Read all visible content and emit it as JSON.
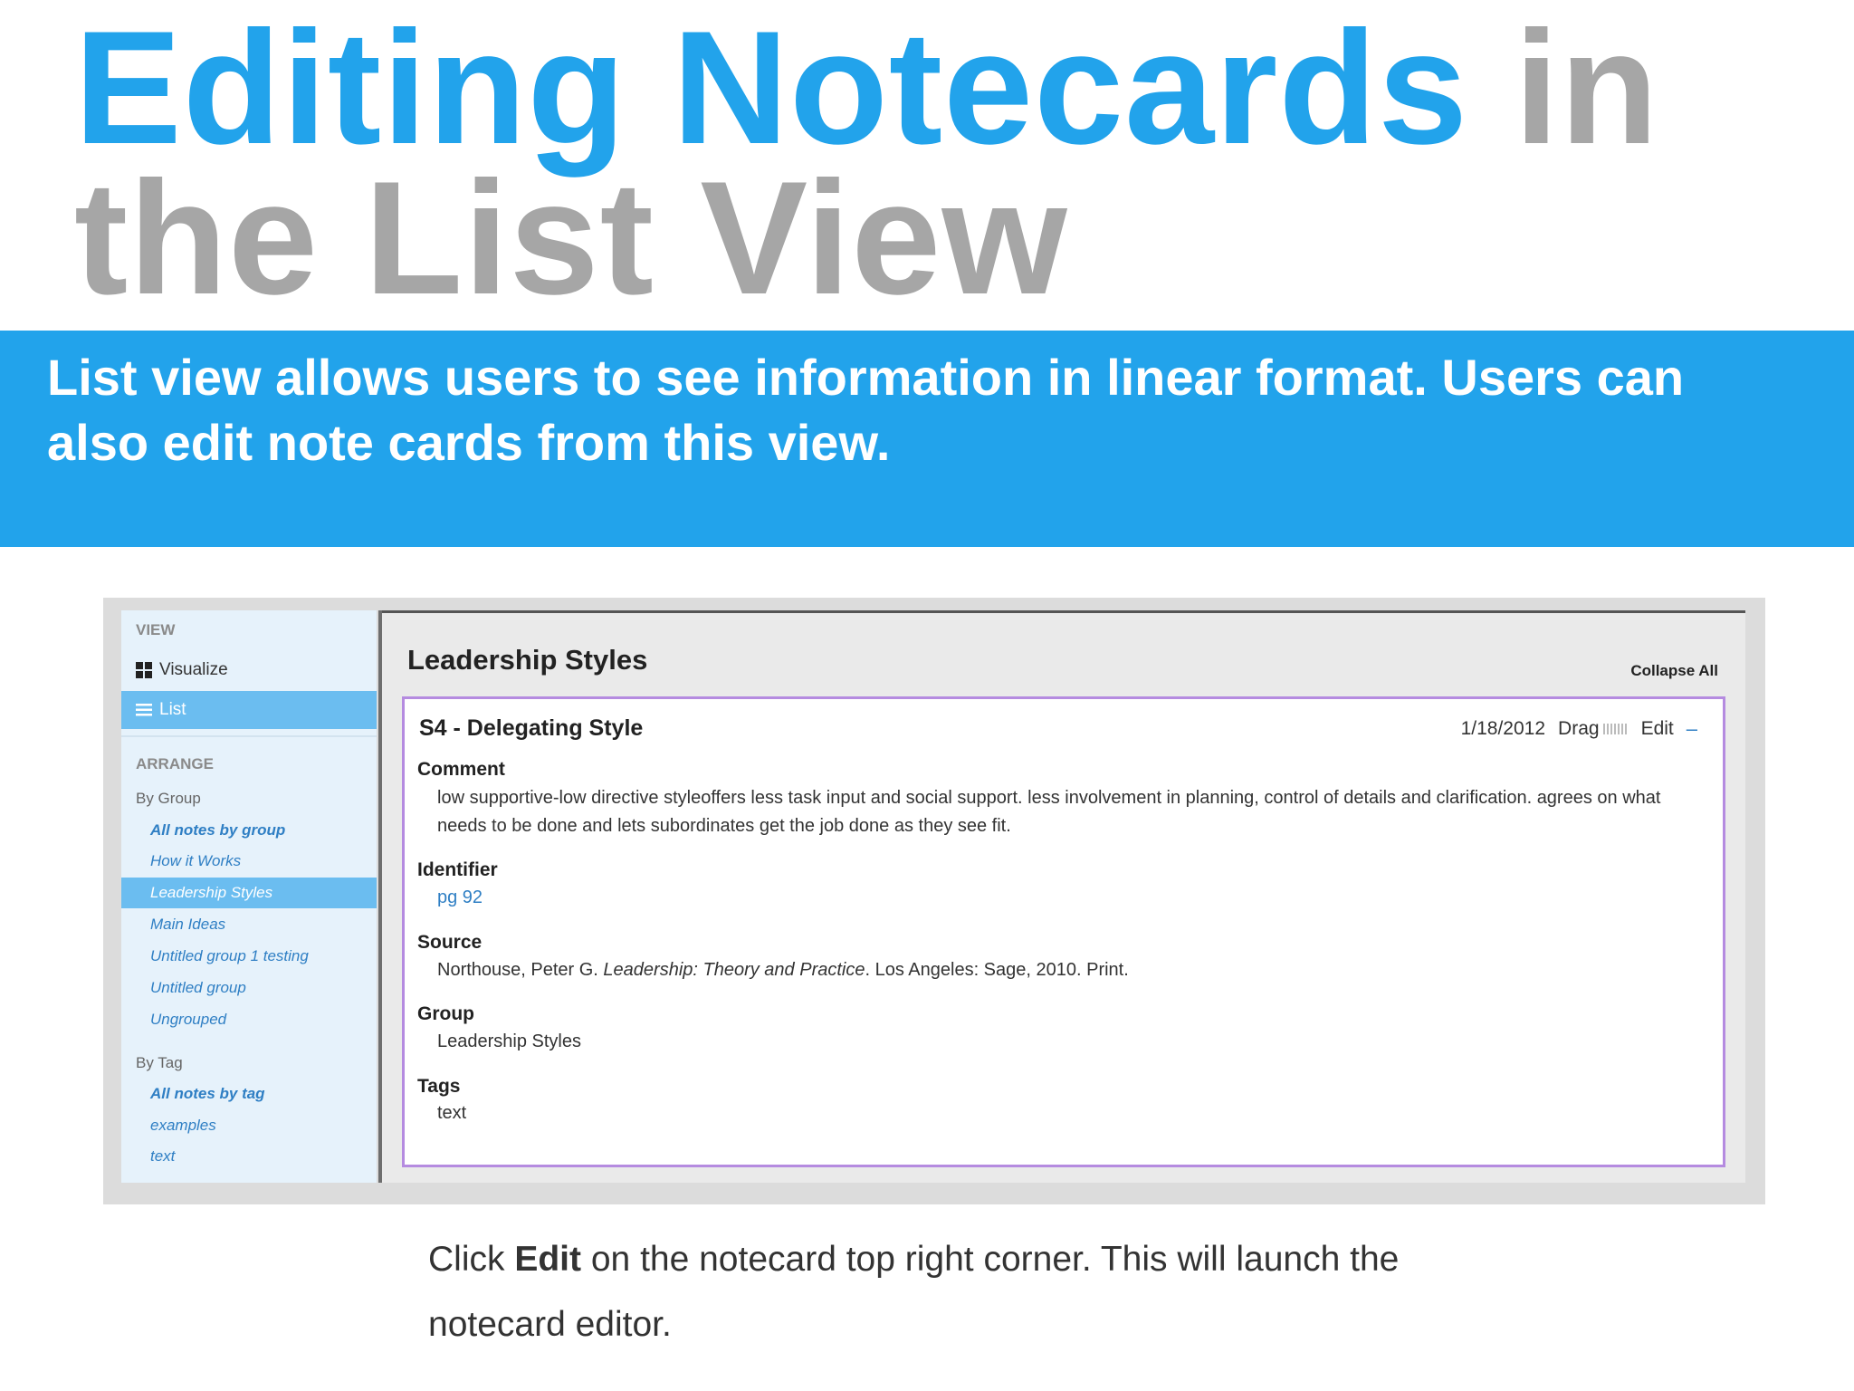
{
  "slide": {
    "title_part1": "Editing Notecards",
    "title_part2": " in",
    "title_line2": "the List View",
    "banner_text": "List view allows users to see information in linear format. Users can also edit note cards from this view.",
    "caption_pre": "Click ",
    "caption_bold": "Edit",
    "caption_post": " on the notecard top right corner. This will launch the notecard editor."
  },
  "sidebar": {
    "view_label": "VIEW",
    "visualize": "Visualize",
    "list": "List",
    "arrange_label": "ARRANGE",
    "by_group": "By Group",
    "groups": [
      "All notes by group",
      "How it Works",
      "Leadership Styles",
      "Main Ideas",
      "Untitled group 1 testing",
      "Untitled group",
      "Ungrouped"
    ],
    "by_tag": "By Tag",
    "tags": [
      "All notes by tag",
      "examples",
      "text"
    ]
  },
  "main": {
    "group_title": "Leadership Styles",
    "collapse_all": "Collapse All"
  },
  "card": {
    "title": "S4 - Delegating Style",
    "date": "1/18/2012",
    "drag": "Drag",
    "edit": "Edit",
    "collapse_symbol": "–",
    "comment_label": "Comment",
    "comment": "low supportive-low directive styleoffers less task input and social support. less involvement in planning, control of details and clarification. agrees on what needs to be done and lets subordinates get the job done as they see fit.",
    "identifier_label": "Identifier",
    "identifier": "pg 92",
    "source_label": "Source",
    "source_pre": "Northouse, Peter G. ",
    "source_italic": "Leadership: Theory and Practice",
    "source_post": ". Los Angeles: Sage, 2010. Print.",
    "group_label": "Group",
    "group": "Leadership Styles",
    "tags_label": "Tags",
    "tags": "text"
  },
  "colors": {
    "brand_blue": "#22a3eb",
    "title_gray": "#a6a6a6",
    "card_border": "#b58be0",
    "sidebar_active": "#6bbdf0"
  }
}
